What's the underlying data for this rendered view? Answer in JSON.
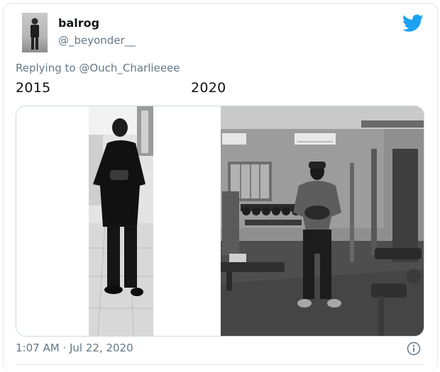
{
  "tweet": {
    "author_name": "balrog",
    "author_handle": "@_beyonder__",
    "replying_prefix": "Replying to",
    "replying_to": "@Ouch_Charlieeee",
    "label_before": "2015",
    "label_after": "2020",
    "timestamp": "1:07 AM · Jul 22, 2020"
  },
  "icons": {
    "brand": "twitter-bird-icon",
    "info": "info-icon"
  },
  "colors": {
    "twitter_blue": "#1da1f2",
    "muted_text": "#657786",
    "name_text": "#14171a"
  }
}
